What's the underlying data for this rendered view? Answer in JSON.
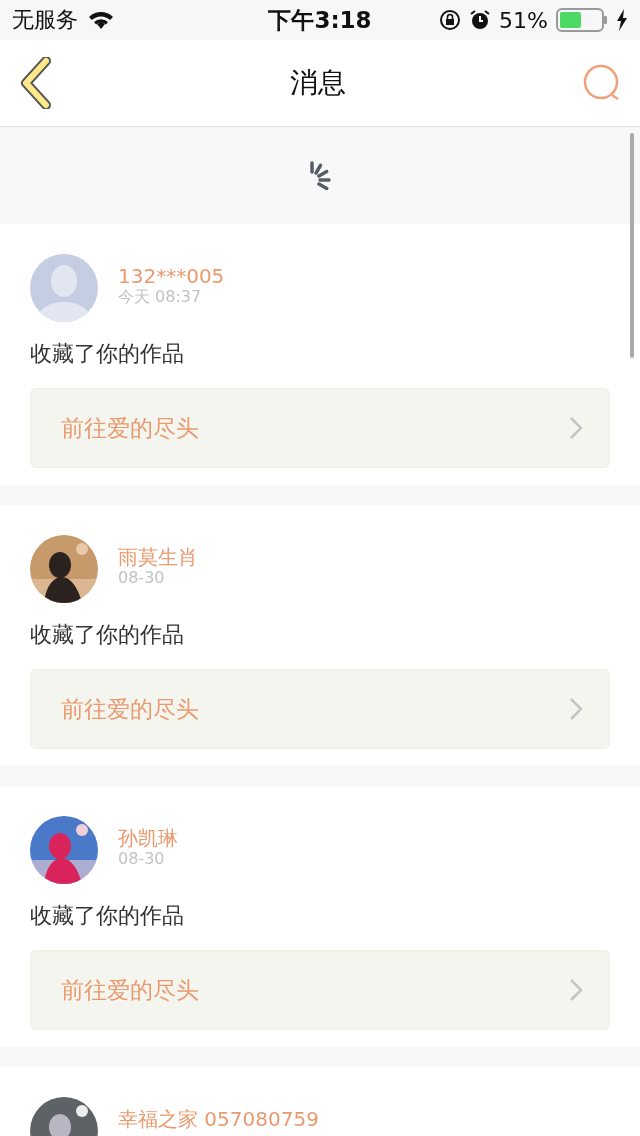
{
  "status_bar": {
    "carrier": "无服务",
    "time": "下午3:18",
    "battery": "51%"
  },
  "nav": {
    "title": "消息"
  },
  "refresh": {
    "loading": true
  },
  "messages": [
    {
      "user": "132***005",
      "time": "今天 08:37",
      "action": "收藏了你的作品",
      "link": "前往爱的尽头",
      "avatar": {
        "kind": "default"
      }
    },
    {
      "user": "雨莫生肖",
      "time": "08-30",
      "action": "收藏了你的作品",
      "link": "前往爱的尽头"
    },
    {
      "user": "孙凯琳",
      "time": "08-30",
      "action": "收藏了你的作品",
      "link": "前往爱的尽头"
    },
    {
      "user": "幸福之家 057080759"
    }
  ]
}
